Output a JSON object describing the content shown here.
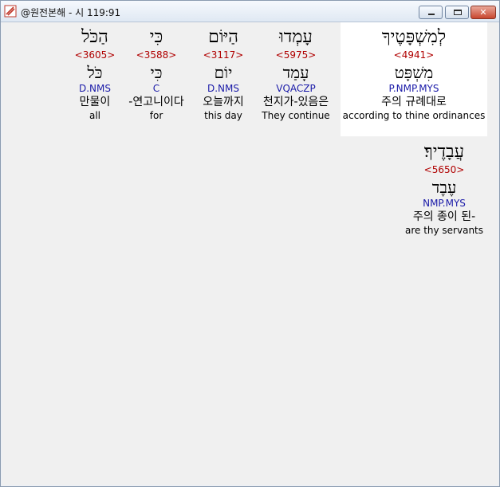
{
  "window": {
    "title": "@원전본해 - 시 119:91"
  },
  "words_row1": [
    {
      "hebrew": "לְמִשְׁפָּטֶיךָ",
      "strong": "<4941>",
      "lemma": "מִשְׁפָּט",
      "morph": "P.NMP.MYS",
      "korean": "주의 규례대로",
      "english": "according to thine ordinances"
    },
    {
      "hebrew": "עָמְדוּ",
      "strong": "<5975>",
      "lemma": "עָמַד",
      "morph": "VQACZP",
      "korean": "천지가-있음은",
      "english": "They continue"
    },
    {
      "hebrew": "הַיּוֹם",
      "strong": "<3117>",
      "lemma": "יוֹם",
      "morph": "D.NMS",
      "korean": "오늘까지",
      "english": "this day"
    },
    {
      "hebrew": "כִּי",
      "strong": "<3588>",
      "lemma": "כִּי",
      "morph": "C",
      "korean": "-연고니이다",
      "english": "for"
    },
    {
      "hebrew": "הַכֹּל",
      "strong": "<3605>",
      "lemma": "כֹּל",
      "morph": "D.NMS",
      "korean": "만물이",
      "english": "all"
    }
  ],
  "words_row2": [
    {
      "hebrew": "עֲבָדֶיךָ׃",
      "strong": "<5650>",
      "lemma": "עֶבֶד",
      "morph": "NMP.MYS",
      "korean": "주의 종이 된-",
      "english": "are thy servants"
    }
  ]
}
